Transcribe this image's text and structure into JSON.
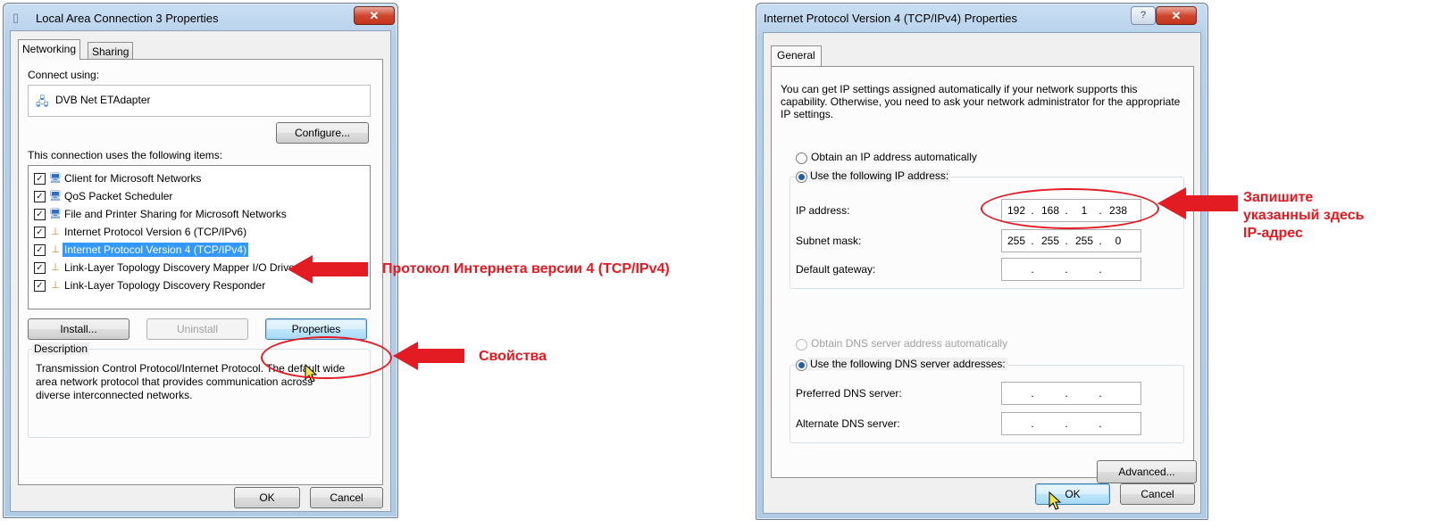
{
  "left_dialog": {
    "title": "Local Area Connection 3 Properties",
    "close_glyph": "✕",
    "tabs": [
      "Networking",
      "Sharing"
    ],
    "connect_using_label": "Connect using:",
    "adapter_name": "DVB Net ETAdapter",
    "configure_label": "Configure...",
    "items_label": "This connection uses the following items:",
    "items": [
      {
        "label": "Client for Microsoft Networks",
        "checked": true
      },
      {
        "label": "QoS Packet Scheduler",
        "checked": true
      },
      {
        "label": "File and Printer Sharing for Microsoft Networks",
        "checked": true
      },
      {
        "label": "Internet Protocol Version 6 (TCP/IPv6)",
        "checked": true
      },
      {
        "label": "Internet Protocol Version 4 (TCP/IPv4)",
        "checked": true,
        "selected": true
      },
      {
        "label": "Link-Layer Topology Discovery Mapper I/O Driver",
        "checked": true
      },
      {
        "label": "Link-Layer Topology Discovery Responder",
        "checked": true
      }
    ],
    "install_label": "Install...",
    "uninstall_label": "Uninstall",
    "properties_label": "Properties",
    "description_label": "Description",
    "description_text": "Transmission Control Protocol/Internet Protocol. The default wide area network protocol that provides communication across diverse interconnected networks.",
    "ok_label": "OK",
    "cancel_label": "Cancel"
  },
  "right_dialog": {
    "title": "Internet Protocol Version 4 (TCP/IPv4) Properties",
    "help_glyph": "?",
    "close_glyph": "✕",
    "tab": "General",
    "intro_text": "You can get IP settings assigned automatically if your network supports this capability. Otherwise, you need to ask your network administrator for the appropriate IP settings.",
    "obtain_ip_label": "Obtain an IP address automatically",
    "use_ip_label": "Use the following IP address:",
    "ip_address_label": "IP address:",
    "ip_address": [
      "192",
      "168",
      "1",
      "238"
    ],
    "subnet_label": "Subnet mask:",
    "subnet_mask": [
      "255",
      "255",
      "255",
      "0"
    ],
    "gateway_label": "Default gateway:",
    "obtain_dns_label": "Obtain DNS server address automatically",
    "use_dns_label": "Use the following DNS server addresses:",
    "preferred_dns_label": "Preferred DNS server:",
    "alternate_dns_label": "Alternate DNS server:",
    "advanced_label": "Advanced...",
    "ok_label": "OK",
    "cancel_label": "Cancel"
  },
  "annotations": {
    "ipv4_note": "Протокол Интернета версии 4 (TCP/IPv4)",
    "properties_note": "Свойства",
    "ip_note_lines": [
      "Запишите",
      "указанный здесь",
      "IP-адрес"
    ],
    "color": "#e8171f"
  }
}
